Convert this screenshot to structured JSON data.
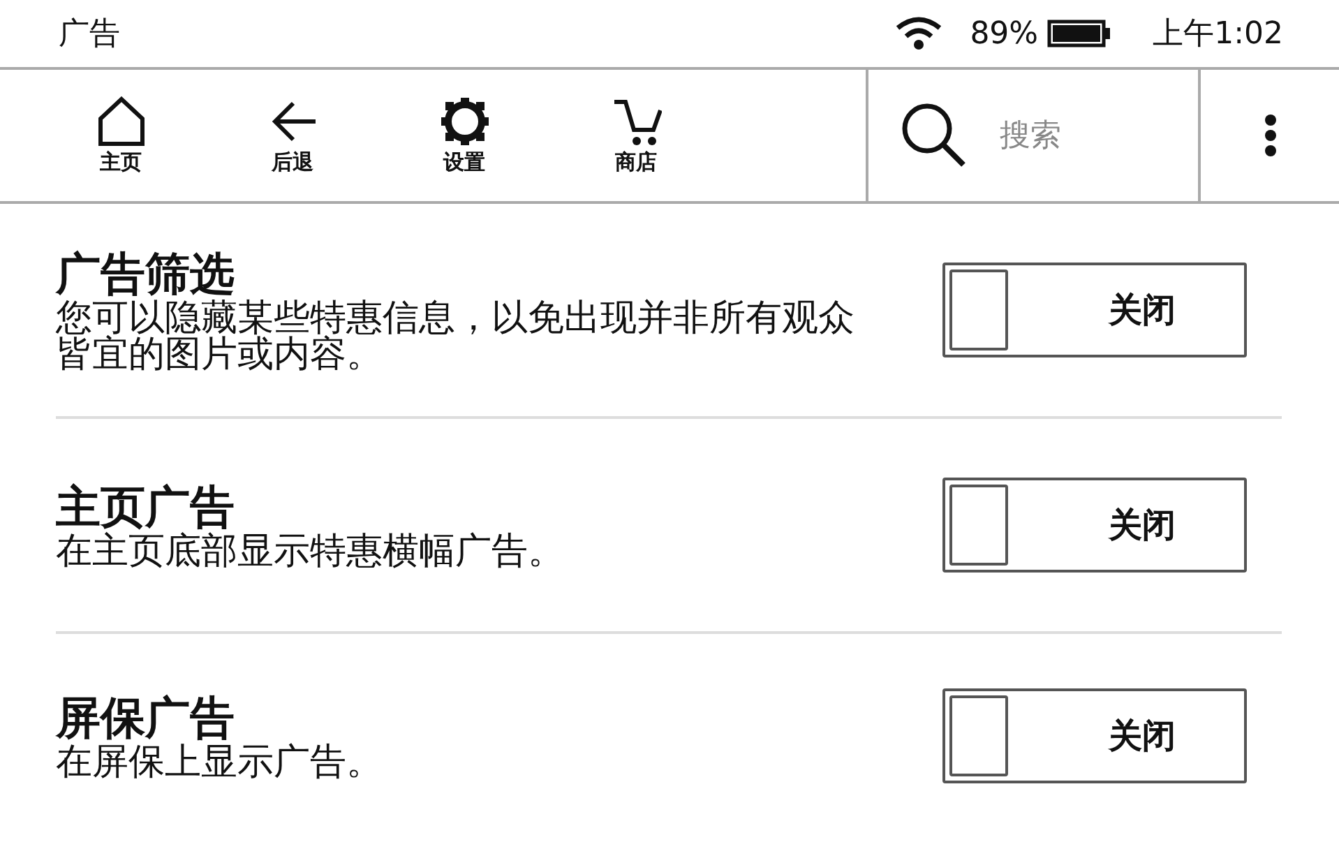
{
  "status_bar": {
    "title": "广告",
    "battery": "89%",
    "time": "上午1:02"
  },
  "toolbar": {
    "items": [
      {
        "kind": "home",
        "label": "主页"
      },
      {
        "kind": "back",
        "label": "后退"
      },
      {
        "kind": "settings",
        "label": "设置"
      },
      {
        "kind": "store",
        "label": "商店"
      }
    ],
    "search": {
      "placeholder": "搜索"
    }
  },
  "settings": [
    {
      "title": "广告筛选",
      "description": "您可以隐藏某些特惠信息，以免出现并非所有观众皆宜的图片或内容。",
      "on": false,
      "state_label": "关闭"
    },
    {
      "title": "主页广告",
      "description": "在主页底部显示特惠横幅广告。",
      "on": false,
      "state_label": "关闭"
    },
    {
      "title": "屏保广告",
      "description": "在屏保上显示广告。",
      "on": false,
      "state_label": "关闭"
    }
  ]
}
